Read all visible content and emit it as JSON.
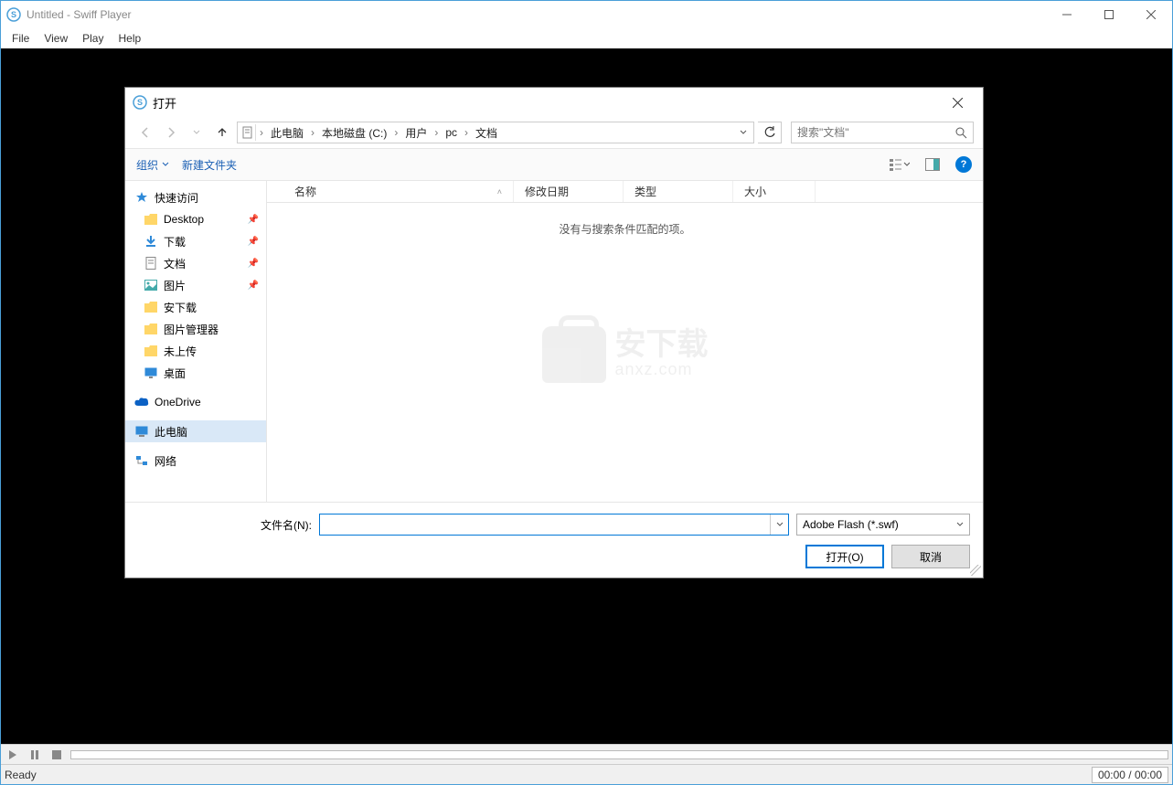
{
  "window": {
    "title": "Untitled - Swiff Player",
    "menu": {
      "file": "File",
      "view": "View",
      "play": "Play",
      "help": "Help"
    }
  },
  "transport": {
    "time": "00:00 / 00:00"
  },
  "status": {
    "ready": "Ready"
  },
  "dialog": {
    "title": "打开",
    "breadcrumb": [
      "此电脑",
      "本地磁盘 (C:)",
      "用户",
      "pc",
      "文档"
    ],
    "search_placeholder": "搜索\"文档\"",
    "toolbar": {
      "organize": "组织",
      "newfolder": "新建文件夹"
    },
    "columns": {
      "name": "名称",
      "date": "修改日期",
      "type": "类型",
      "size": "大小"
    },
    "empty_msg": "没有与搜索条件匹配的项。",
    "tree": {
      "quick": "快速访问",
      "desktop": "Desktop",
      "downloads": "下载",
      "documents": "文档",
      "pictures": "图片",
      "adown": "安下载",
      "picmgr": "图片管理器",
      "notup": "未上传",
      "desktop2": "桌面",
      "onedrive": "OneDrive",
      "thispc": "此电脑",
      "network": "网络"
    },
    "footer": {
      "label": "文件名(N):",
      "filetype": "Adobe Flash (*.swf)",
      "open": "打开(O)",
      "cancel": "取消"
    }
  },
  "watermark": {
    "main": "安下载",
    "sub": "anxz.com"
  }
}
